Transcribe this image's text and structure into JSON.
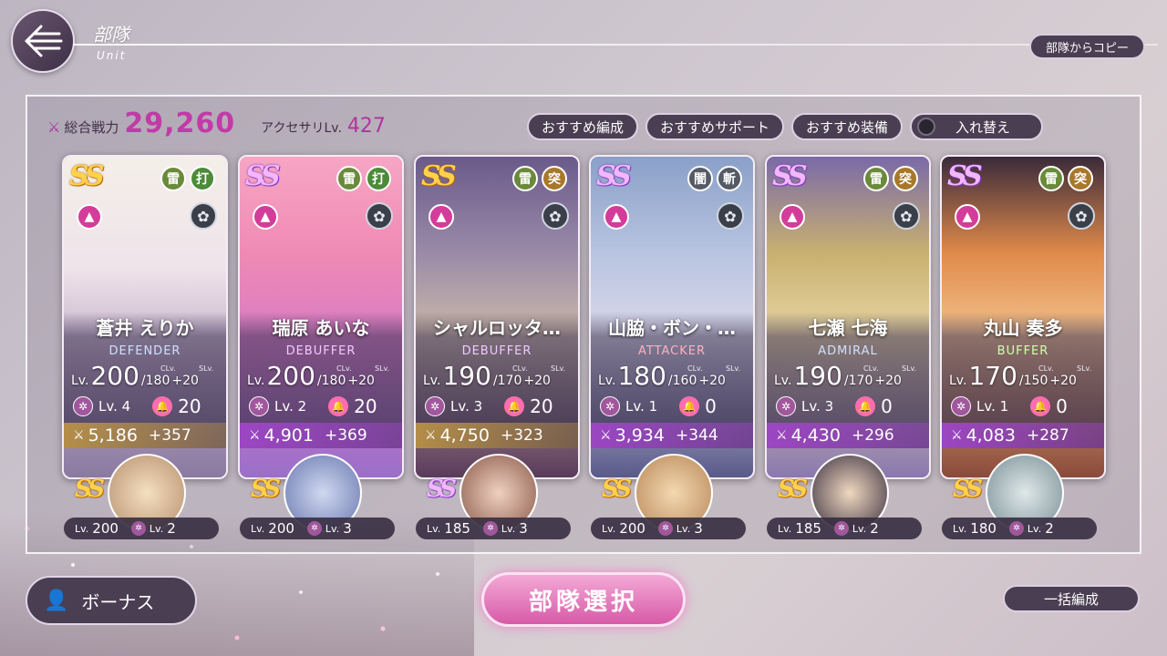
{
  "header": {
    "title": "部隊",
    "subtitle": "Unit",
    "copy_button": "部隊からコピー"
  },
  "summary": {
    "power_label": "総合戦力",
    "power_value": "29,260",
    "accessory_label": "アクセサリLv.",
    "accessory_value": "427"
  },
  "top_buttons": {
    "recommend_formation": "おすすめ編成",
    "recommend_support": "おすすめサポート",
    "recommend_equip": "おすすめ装備",
    "swap": "入れ替え"
  },
  "colors": {
    "accent": "#c23aa8",
    "button_bg": "#4a3e52",
    "select_button": "#d75aa7"
  },
  "units": [
    {
      "rank": "SS",
      "rank_style": "gold",
      "attr1": "雷",
      "attr1_color": "#6a8a3a",
      "attr2": "打",
      "attr2_color": "#4d8a3a",
      "name": "蒼井 えりか",
      "role": "DEFENDER",
      "role_color": "#cfe0ff",
      "lv": "200",
      "max": "/180",
      "sl": "+20",
      "skill_lv": "Lv. 4",
      "bell": "20",
      "power": "5,186",
      "plus": "+357",
      "bar": "gold",
      "art": "linear-gradient(180deg,#f4efe9 0%,#efe3ea 35%,#b6a0c0 70%,#8a7aa0 100%)"
    },
    {
      "rank": "SS",
      "rank_style": "purple",
      "attr1": "雷",
      "attr1_color": "#6a8a3a",
      "attr2": "打",
      "attr2_color": "#4d8a3a",
      "name": "瑞原 あいな",
      "role": "DEBUFFER",
      "role_color": "#f0c8ff",
      "lv": "200",
      "max": "/180",
      "sl": "+20",
      "skill_lv": "Lv. 2",
      "bell": "20",
      "power": "4,901",
      "plus": "+369",
      "bar": "purp",
      "art": "linear-gradient(180deg,#f6a6c4 0%,#f08ab4 30%,#d57ac6 60%,#9a6fc8 100%)"
    },
    {
      "rank": "SS",
      "rank_style": "gold",
      "attr1": "雷",
      "attr1_color": "#6a8a3a",
      "attr2": "突",
      "attr2_color": "#a8782a",
      "name": "シャルロッタ…",
      "role": "DEBUFFER",
      "role_color": "#f0c8ff",
      "lv": "190",
      "max": "/170",
      "sl": "+20",
      "skill_lv": "Lv. 3",
      "bell": "20",
      "power": "4,750",
      "plus": "+323",
      "bar": "gold",
      "art": "linear-gradient(180deg,#6a5a8a 0%,#9a8aa8 30%,#c9b8a8 55%,#5a3a5a 100%)"
    },
    {
      "rank": "SS",
      "rank_style": "purple",
      "attr1": "闇",
      "attr1_color": "#555a66",
      "attr2": "斬",
      "attr2_color": "#555a66",
      "name": "山脇・ボン・…",
      "role": "ATTACKER",
      "role_color": "#ffb0c0",
      "lv": "180",
      "max": "/160",
      "sl": "+20",
      "skill_lv": "Lv. 1",
      "bell": "0",
      "power": "3,934",
      "plus": "+344",
      "bar": "purp",
      "art": "linear-gradient(180deg,#8aa0c8 0%,#b8c4e0 30%,#d8d8ea 55%,#5a5a8a 100%)"
    },
    {
      "rank": "SS",
      "rank_style": "purple",
      "attr1": "雷",
      "attr1_color": "#6a8a3a",
      "attr2": "突",
      "attr2_color": "#a8782a",
      "name": "七瀬 七海",
      "role": "ADMIRAL",
      "role_color": "#cfe0ff",
      "lv": "190",
      "max": "/170",
      "sl": "+20",
      "skill_lv": "Lv. 3",
      "bell": "0",
      "power": "4,430",
      "plus": "+296",
      "bar": "purp",
      "art": "linear-gradient(180deg,#7a6aa8 0%,#c8b070 30%,#e6d4a0 55%,#8a78b0 100%)"
    },
    {
      "rank": "SS",
      "rank_style": "purple",
      "attr1": "雷",
      "attr1_color": "#6a8a3a",
      "attr2": "突",
      "attr2_color": "#a8782a",
      "name": "丸山 奏多",
      "role": "BUFFER",
      "role_color": "#d0ffb0",
      "lv": "170",
      "max": "/150",
      "sl": "+20",
      "skill_lv": "Lv. 1",
      "bell": "0",
      "power": "4,083",
      "plus": "+287",
      "bar": "purp",
      "art": "linear-gradient(180deg,#3a2a3a 0%,#e08a4a 30%,#f2c08a 55%,#8a4a3a 100%)"
    }
  ],
  "supports": [
    {
      "rank": "SS",
      "rank_style": "gold",
      "lv_label": "Lv.",
      "lv": "200",
      "sk_label": "Lv.",
      "sk": "2",
      "art": "radial-gradient(circle,#f4e0c0,#b89070)"
    },
    {
      "rank": "SS",
      "rank_style": "gold",
      "lv_label": "Lv.",
      "lv": "200",
      "sk_label": "Lv.",
      "sk": "3",
      "art": "radial-gradient(circle,#d0d8f0,#6a78b0)"
    },
    {
      "rank": "SS",
      "rank_style": "purple",
      "lv_label": "Lv.",
      "lv": "185",
      "sk_label": "Lv.",
      "sk": "3",
      "art": "radial-gradient(circle,#f0d0c0,#8a5a4a)"
    },
    {
      "rank": "SS",
      "rank_style": "gold",
      "lv_label": "Lv.",
      "lv": "200",
      "sk_label": "Lv.",
      "sk": "3",
      "art": "radial-gradient(circle,#f4d8b0,#b8885a)"
    },
    {
      "rank": "SS",
      "rank_style": "gold",
      "lv_label": "Lv.",
      "lv": "185",
      "sk_label": "Lv.",
      "sk": "2",
      "art": "radial-gradient(circle,#f0d8c0,#3a3040)"
    },
    {
      "rank": "SS",
      "rank_style": "gold",
      "lv_label": "Lv.",
      "lv": "180",
      "sk_label": "Lv.",
      "sk": "2",
      "art": "radial-gradient(circle,#e0e8e8,#7a9098)"
    }
  ],
  "card_labels": {
    "lv": "Lv.",
    "clv": "CLv.",
    "slv": "SLv."
  },
  "bottom": {
    "bonus": "ボーナス",
    "select": "部隊選択",
    "bulk": "一括編成"
  }
}
